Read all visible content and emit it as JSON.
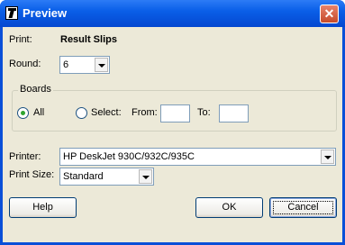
{
  "window": {
    "title": "Preview"
  },
  "print": {
    "label": "Print:",
    "value": "Result Slips"
  },
  "round": {
    "label": "Round:",
    "selected": "6"
  },
  "boards": {
    "legend": "Boards",
    "all_label": "All",
    "select_label": "Select:",
    "from_label": "From:",
    "to_label": "To:",
    "from_value": "",
    "to_value": ""
  },
  "printer": {
    "label": "Printer:",
    "selected": "HP DeskJet 930C/932C/935C"
  },
  "print_size": {
    "label": "Print Size:",
    "selected": "Standard"
  },
  "buttons": {
    "help": "Help",
    "ok": "OK",
    "cancel": "Cancel"
  },
  "icons": {
    "app": "app-logo-icon",
    "close": "close-icon"
  },
  "colors": {
    "titlebar": "#0a5fe8",
    "dialog_bg": "#ece9d8",
    "radio_check": "#2fa42f"
  }
}
